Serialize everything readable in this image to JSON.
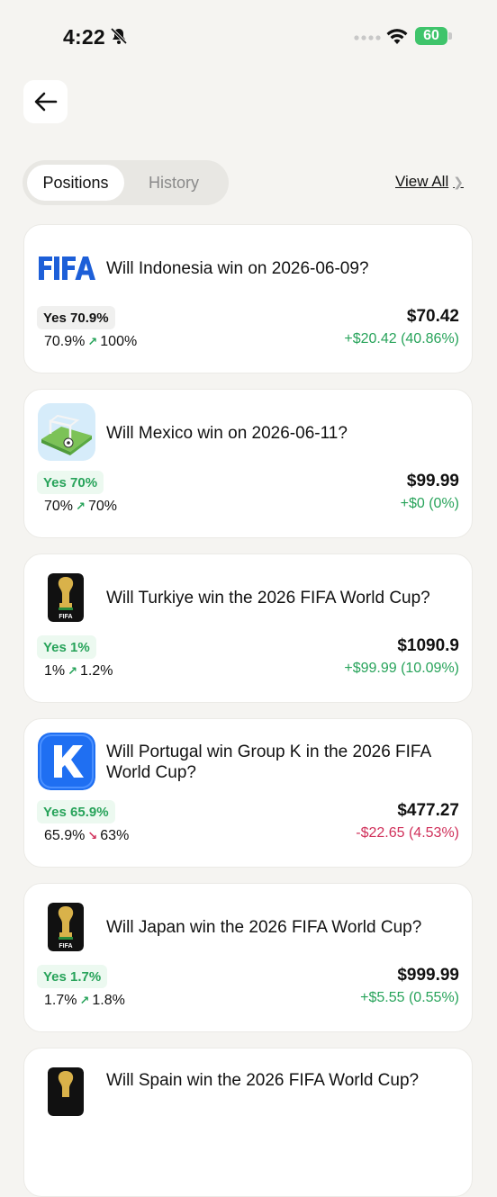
{
  "status": {
    "time": "4:22",
    "battery": "60"
  },
  "tabs": {
    "positions": "Positions",
    "history": "History"
  },
  "view_all": "View All",
  "positions": [
    {
      "title": "Will Indonesia win on 2026-06-09?",
      "icon": "fifa-wordmark-icon",
      "badge": "Yes 70.9%",
      "from": "70.9%",
      "direction": "up",
      "to": "100%",
      "value": "$70.42",
      "change": "+$20.42 (40.86%)"
    },
    {
      "title": "Will Mexico win on 2026-06-11?",
      "icon": "soccer-field-icon",
      "badge": "Yes 70%",
      "from": "70%",
      "direction": "up",
      "to": "70%",
      "value": "$99.99",
      "change": "+$0 (0%)"
    },
    {
      "title": "Will Turkiye win the 2026 FIFA World Cup?",
      "icon": "world-cup-trophy-icon",
      "badge": "Yes 1%",
      "from": "1%",
      "direction": "up",
      "to": "1.2%",
      "value": "$1090.9",
      "change": "+$99.99 (10.09%)"
    },
    {
      "title": "Will Portugal win Group K in the 2026 FIFA World Cup?",
      "icon": "k-logo-icon",
      "badge": "Yes 65.9%",
      "from": "65.9%",
      "direction": "down",
      "to": "63%",
      "value": "$477.27",
      "change": "-$22.65 (4.53%)"
    },
    {
      "title": "Will Japan win the 2026 FIFA World Cup?",
      "icon": "world-cup-trophy-icon",
      "badge": "Yes 1.7%",
      "from": "1.7%",
      "direction": "up",
      "to": "1.8%",
      "value": "$999.99",
      "change": "+$5.55 (0.55%)"
    },
    {
      "title": "Will Spain win the 2026 FIFA World Cup?",
      "icon": "world-cup-trophy-icon"
    }
  ],
  "colors": {
    "positive": "#27a35a",
    "negative": "#d0305a",
    "battery": "#3fc46b"
  }
}
